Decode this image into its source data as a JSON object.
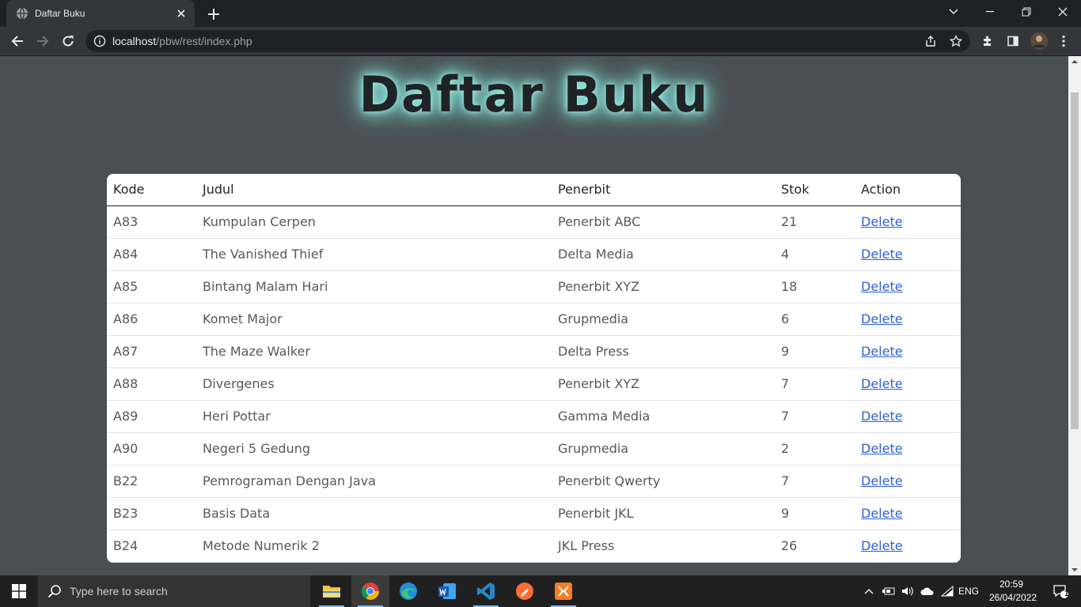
{
  "browser": {
    "tab_title": "Daftar Buku",
    "url_host": "localhost",
    "url_path": "/pbw/rest/index.php"
  },
  "page": {
    "title": "Daftar Buku",
    "table": {
      "headers": [
        "Kode",
        "Judul",
        "Penerbit",
        "Stok",
        "Action"
      ],
      "rows": [
        {
          "kode": "A83",
          "judul": "Kumpulan Cerpen",
          "penerbit": "Penerbit ABC",
          "stok": "21",
          "action": "Delete"
        },
        {
          "kode": "A84",
          "judul": "The Vanished Thief",
          "penerbit": "Delta Media",
          "stok": "4",
          "action": "Delete"
        },
        {
          "kode": "A85",
          "judul": "Bintang Malam Hari",
          "penerbit": "Penerbit XYZ",
          "stok": "18",
          "action": "Delete"
        },
        {
          "kode": "A86",
          "judul": "Komet Major",
          "penerbit": "Grupmedia",
          "stok": "6",
          "action": "Delete"
        },
        {
          "kode": "A87",
          "judul": "The Maze Walker",
          "penerbit": "Delta Press",
          "stok": "9",
          "action": "Delete"
        },
        {
          "kode": "A88",
          "judul": "Divergenes",
          "penerbit": "Penerbit XYZ",
          "stok": "7",
          "action": "Delete"
        },
        {
          "kode": "A89",
          "judul": "Heri Pottar",
          "penerbit": "Gamma Media",
          "stok": "7",
          "action": "Delete"
        },
        {
          "kode": "A90",
          "judul": "Negeri 5 Gedung",
          "penerbit": "Grupmedia",
          "stok": "2",
          "action": "Delete"
        },
        {
          "kode": "B22",
          "judul": "Pemrograman Dengan Java",
          "penerbit": "Penerbit Qwerty",
          "stok": "7",
          "action": "Delete"
        },
        {
          "kode": "B23",
          "judul": "Basis Data",
          "penerbit": "Penerbit JKL",
          "stok": "9",
          "action": "Delete"
        },
        {
          "kode": "B24",
          "judul": "Metode Numerik 2",
          "penerbit": "JKL Press",
          "stok": "26",
          "action": "Delete"
        }
      ]
    }
  },
  "taskbar": {
    "search_placeholder": "Type here to search",
    "language": "ENG",
    "time": "20:59",
    "date": "26/04/2022",
    "notification_count": "1",
    "apps": [
      "file-explorer",
      "chrome",
      "edge",
      "word",
      "vscode",
      "postman",
      "xampp"
    ]
  },
  "colors": {
    "page_bg": "#4b4f52",
    "title_glow": "#8fe3da",
    "link": "#2d5fd8",
    "browser_frame": "#202124",
    "toolbar": "#35363a"
  }
}
